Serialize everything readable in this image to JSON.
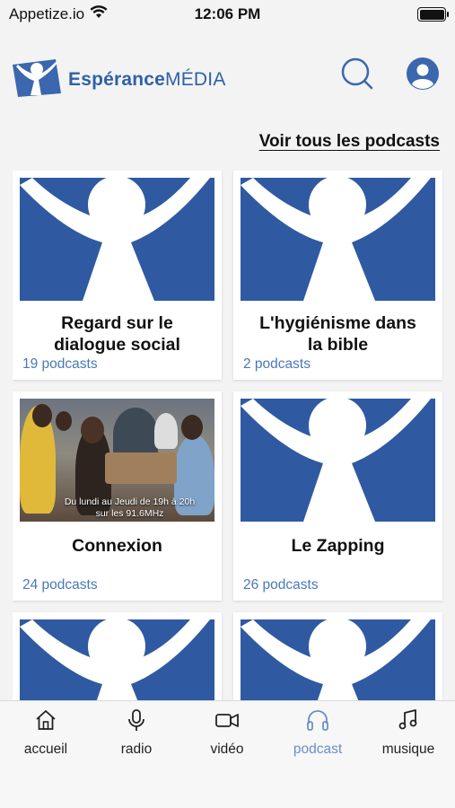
{
  "status_bar": {
    "carrier": "Appetize.io",
    "time": "12:06 PM"
  },
  "header": {
    "brand_regular": "Espérance",
    "brand_bold": "MÉDIA"
  },
  "see_all": "Voir tous les podcasts",
  "cards": [
    {
      "title_line1": "Regard sur le",
      "title_line2": "dialogue social",
      "count": "19 podcasts"
    },
    {
      "title_line1": "L'hygiénisme dans",
      "title_line2": "la bible",
      "count": "2 podcasts"
    },
    {
      "title_line1": "Connexion",
      "title_line2": "",
      "count": "24 podcasts",
      "caption_line1": "Du lundi au Jeudi de 19h à 20h",
      "caption_line2": "sur les 91.6MHz"
    },
    {
      "title_line1": "Le Zapping",
      "title_line2": "",
      "count": "26 podcasts"
    }
  ],
  "tabs": [
    {
      "label": "accueil",
      "icon": "home-icon"
    },
    {
      "label": "radio",
      "icon": "microphone-icon"
    },
    {
      "label": "vidéo",
      "icon": "video-camera-icon"
    },
    {
      "label": "podcast",
      "icon": "headphones-icon",
      "active": true
    },
    {
      "label": "musique",
      "icon": "music-note-icon"
    }
  ],
  "colors": {
    "brand_blue": "#2f5aa2",
    "accent_blue": "#4a78b8",
    "active_tab": "#6a8fc4"
  }
}
